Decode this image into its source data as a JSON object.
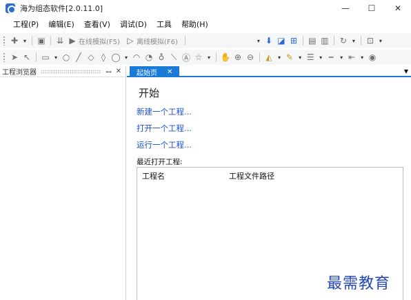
{
  "window": {
    "title": "海为组态软件[2.0.11.0]",
    "minimize_glyph": "—",
    "maximize_glyph": "☐",
    "close_glyph": "✕"
  },
  "menu": {
    "items": [
      "工程(P)",
      "编辑(E)",
      "查看(V)",
      "调试(D)",
      "工具",
      "帮助(H)"
    ]
  },
  "toolbar": {
    "online_sim_label": "在线模拟(F5)",
    "offline_sim_label": "离线模拟(F6)"
  },
  "left_panel": {
    "title": "工程浏览器",
    "pin_glyph": "ꟷ",
    "close_glyph": "✕"
  },
  "tabs": {
    "active_label": "起始页",
    "close_glyph": "✕"
  },
  "start_page": {
    "heading": "开始",
    "links": [
      "新建一个工程...",
      "打开一个工程...",
      "运行一个工程..."
    ],
    "recent_label": "最近打开工程:",
    "columns": [
      "工程名",
      "工程文件路径"
    ]
  },
  "watermark": "最需教育",
  "colors": {
    "accent": "#1a7ad8",
    "link": "#1b4fd6",
    "watermark": "#2546b8"
  }
}
